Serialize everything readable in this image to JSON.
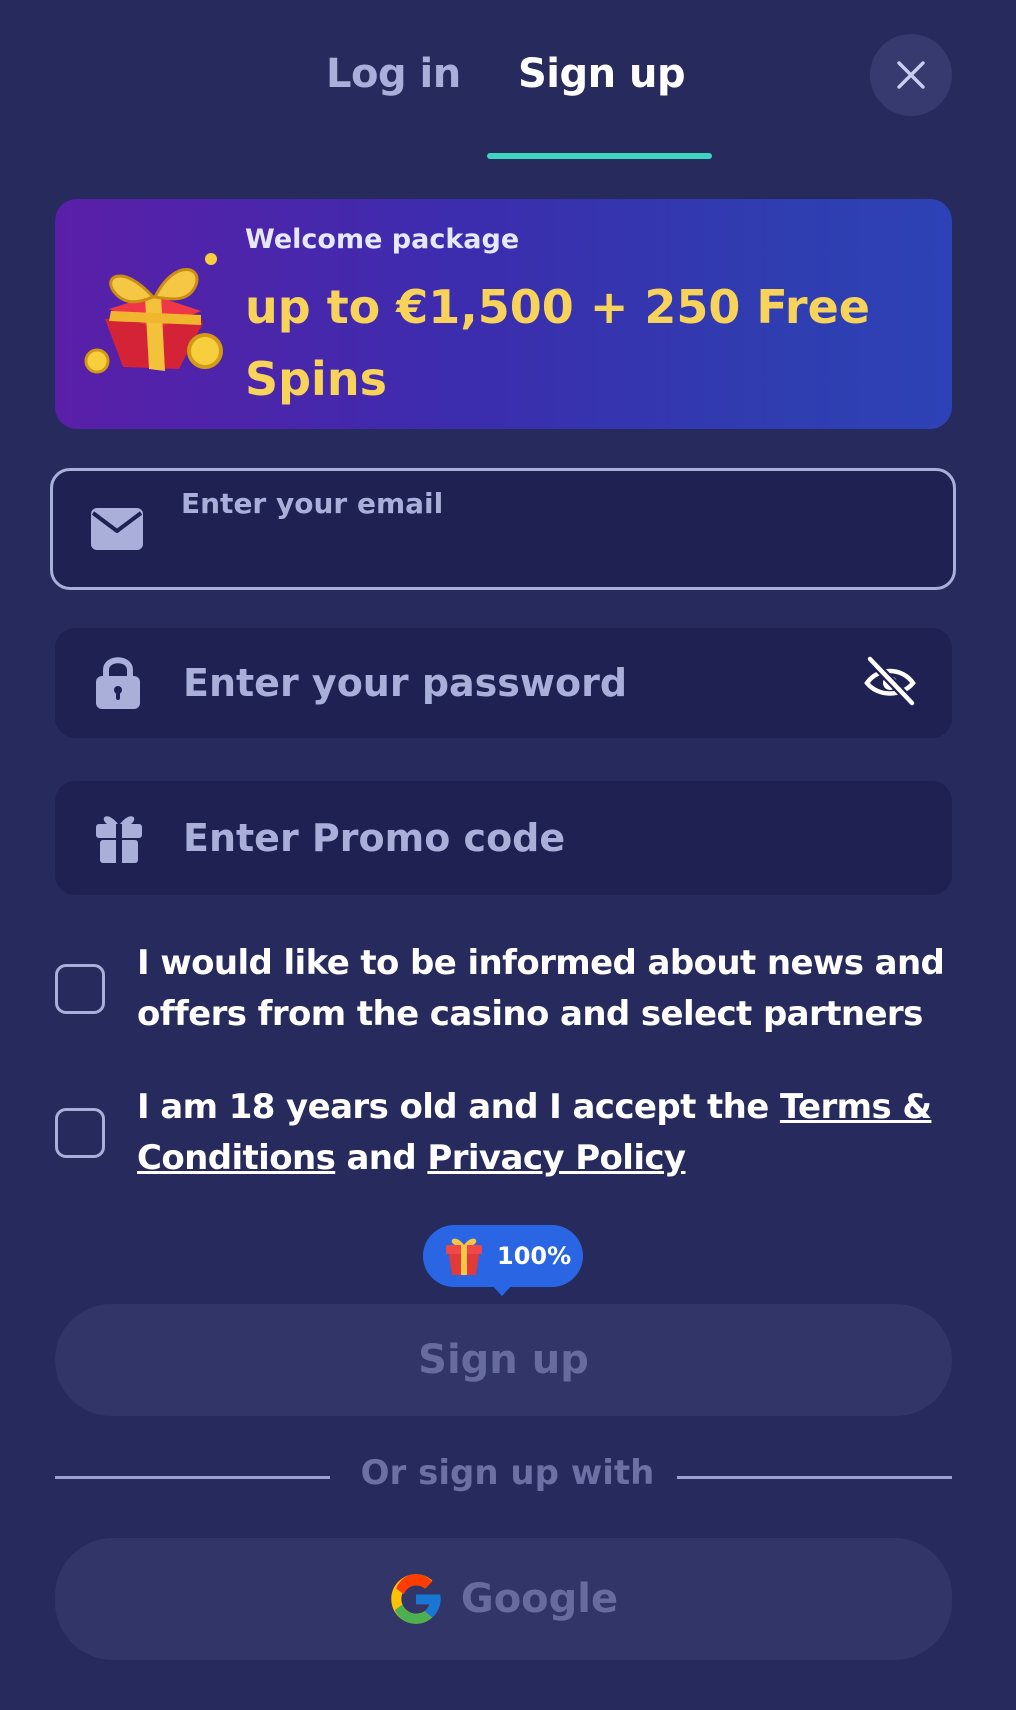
{
  "tabs": {
    "login": "Log in",
    "signup": "Sign up",
    "active": "signup"
  },
  "banner": {
    "subtitle": "Welcome package",
    "title": "up to €1,500 + 250 Free Spins"
  },
  "email": {
    "label": "Enter your email",
    "value": ""
  },
  "password": {
    "placeholder": "Enter your password",
    "value": ""
  },
  "promo": {
    "placeholder": "Enter Promo code",
    "value": ""
  },
  "consent_news": {
    "text": "I would like to be informed about news and offers from the casino and select partners",
    "checked": false
  },
  "consent_terms": {
    "prefix": "I am 18 years old and I accept the ",
    "terms_link": "Terms & Conditions",
    "middle": " and ",
    "privacy_link": "Privacy Policy",
    "checked": false
  },
  "badge": {
    "text": "100%"
  },
  "signup_button": "Sign up",
  "divider": "Or sign up with",
  "google_button": "Google",
  "colors": {
    "background": "#272a5c",
    "accent_underline": "#3fd4c0",
    "banner_text": "#f7d35a",
    "badge": "#2a66e3",
    "muted": "#a9afd9"
  },
  "icons": [
    "close-icon",
    "gift-box-art",
    "email-icon",
    "lock-icon",
    "eye-off-icon",
    "gift-icon",
    "google-icon"
  ]
}
